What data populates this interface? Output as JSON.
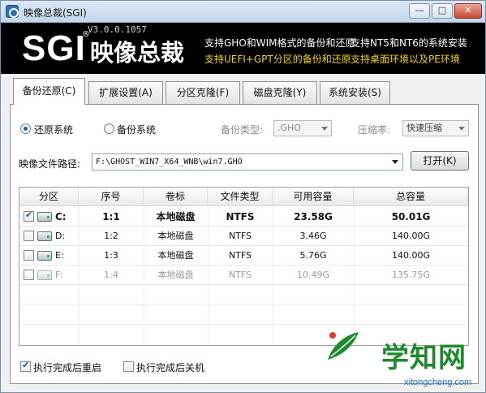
{
  "window": {
    "title": "映像总裁(SGI)",
    "minimize_label": "—",
    "maximize_label": "□",
    "close_label": "✕"
  },
  "banner": {
    "logo_text": "SGI",
    "logo_reg": "®",
    "logo_cn": "映像总裁",
    "version": "V3.0.0.1057",
    "features": [
      "支持GHO和WIM格式的备份和还原",
      "支持NT5和NT6的系统安装",
      "支持UEFI+GPT分区的备份和还原",
      "支持桌面环境以及PE环境"
    ],
    "feature_colors": [
      "#ffffff",
      "#f2d21a"
    ]
  },
  "tabs": [
    {
      "label": "备份还原(C)",
      "active": true
    },
    {
      "label": "扩展设置(A)",
      "active": false
    },
    {
      "label": "分区克隆(F)",
      "active": false
    },
    {
      "label": "磁盘克隆(Y)",
      "active": false
    },
    {
      "label": "系统安装(S)",
      "active": false
    }
  ],
  "mode": {
    "restore_label": "还原系统",
    "backup_label": "备份系统",
    "selected": "还原系统",
    "backup_type_label": "备份类型:",
    "backup_type_value": ".GHO",
    "compression_label": "压缩率:",
    "compression_value": "快速压缩"
  },
  "image_path": {
    "label": "映像文件路径:",
    "value": "F:\\GHOST_WIN7_X64_WNB\\win7.GHO",
    "open_button": "打开(K)"
  },
  "table": {
    "columns": [
      "分区",
      "序号",
      "卷标",
      "文件类型",
      "可用容量",
      "总容量"
    ],
    "rows": [
      {
        "checked": true,
        "partition": "C:",
        "index": "1:1",
        "label": "本地磁盘",
        "fs": "NTFS",
        "free": "23.58G",
        "total": "50.01G",
        "style": "bold"
      },
      {
        "checked": false,
        "partition": "D:",
        "index": "1:2",
        "label": "本地磁盘",
        "fs": "NTFS",
        "free": "3.46G",
        "total": "140.00G",
        "style": "normal"
      },
      {
        "checked": false,
        "partition": "E:",
        "index": "1:3",
        "label": "本地磁盘",
        "fs": "NTFS",
        "free": "5.76G",
        "total": "140.00G",
        "style": "normal"
      },
      {
        "checked": false,
        "partition": "F:",
        "index": "1:4",
        "label": "本地磁盘",
        "fs": "NTFS",
        "free": "10.49G",
        "total": "135.75G",
        "style": "dim"
      }
    ]
  },
  "options": {
    "reboot_label": "执行完成后重启",
    "reboot_checked": true,
    "shutdown_label": "执行完成后关机",
    "shutdown_checked": false
  },
  "watermark": {
    "text": "学知网",
    "url": "xitongcheng.com",
    "color": "#1d8a2c"
  }
}
